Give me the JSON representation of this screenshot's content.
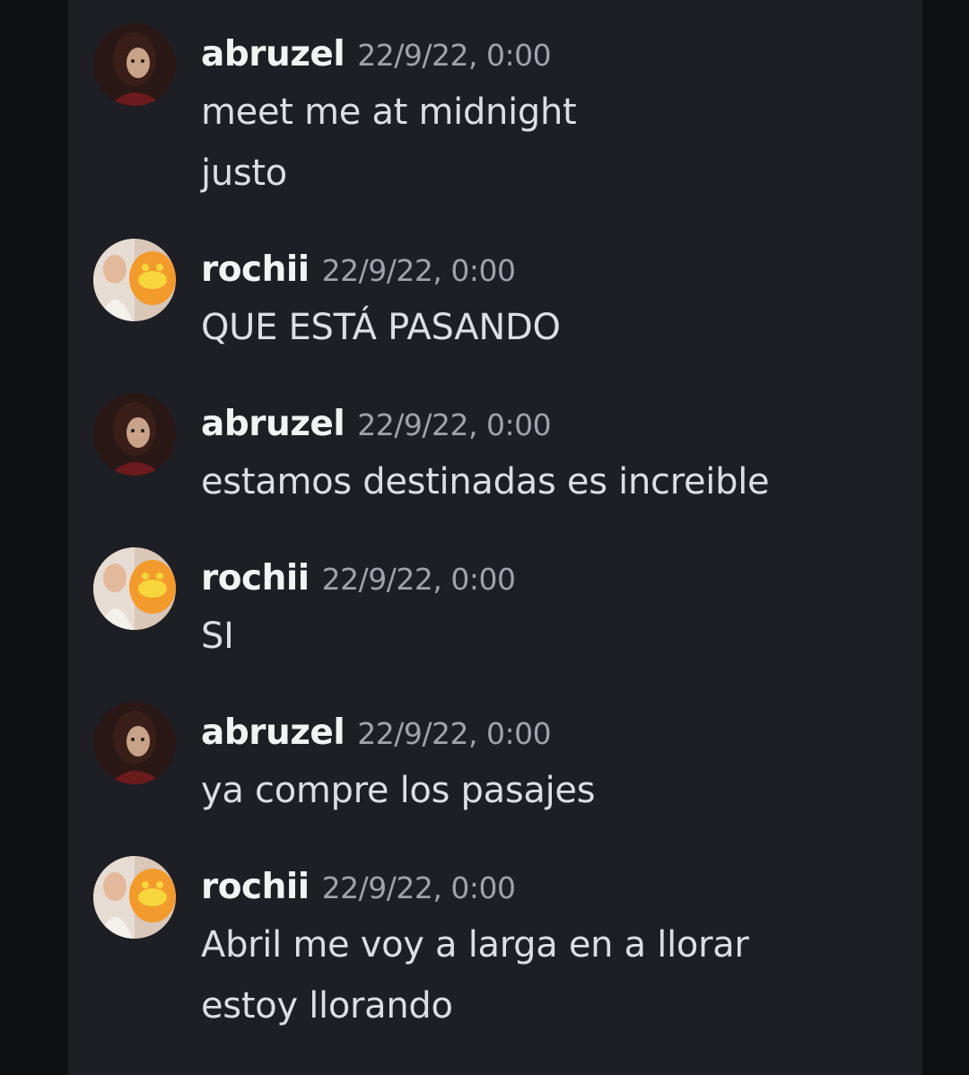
{
  "messages": [
    {
      "author": "abruzel",
      "timestamp": "22/9/22, 0:00",
      "avatar": "abruzel-avatar",
      "lines": [
        "meet me at midnight",
        "justo"
      ]
    },
    {
      "author": "rochii",
      "timestamp": "22/9/22, 0:00",
      "avatar": "rochii-avatar",
      "lines": [
        "QUE ESTÁ PASANDO"
      ]
    },
    {
      "author": "abruzel",
      "timestamp": "22/9/22, 0:00",
      "avatar": "abruzel-avatar",
      "lines": [
        "estamos destinadas es increible"
      ]
    },
    {
      "author": "rochii",
      "timestamp": "22/9/22, 0:00",
      "avatar": "rochii-avatar",
      "lines": [
        "SI"
      ]
    },
    {
      "author": "abruzel",
      "timestamp": "22/9/22, 0:00",
      "avatar": "abruzel-avatar",
      "lines": [
        "ya compre los pasajes"
      ]
    },
    {
      "author": "rochii",
      "timestamp": "22/9/22, 0:00",
      "avatar": "rochii-avatar",
      "lines": [
        "Abril me voy a larga en a llorar",
        "estoy llorando"
      ]
    }
  ],
  "colors": {
    "background": "#0f1013",
    "panel": "#1e1f24",
    "username": "#f2f3f5",
    "timestamp": "#a0a3aa",
    "text": "#dcdee3"
  }
}
